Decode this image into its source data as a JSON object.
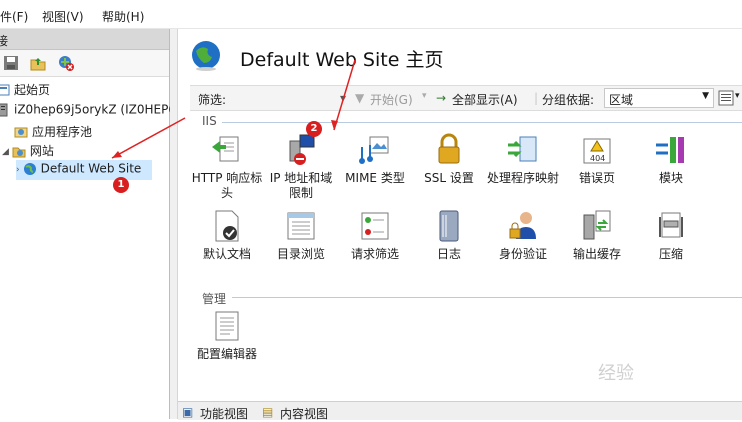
{
  "menu": {
    "items": [
      "件(F)",
      "视图(V)",
      "帮助(H)"
    ]
  },
  "connections": {
    "header": "接",
    "tree": {
      "start_page": "起始页",
      "server": "iZ0hep69j5orykZ (IZ0HEP69",
      "app_pools": "应用程序池",
      "sites": "网站",
      "default_site": "Default Web Site"
    }
  },
  "main": {
    "title": "Default Web Site 主页",
    "filter": {
      "label": "筛选:",
      "start_label": "开始(G)",
      "show_all_label": "全部显示(A)",
      "group_by_label": "分组依据:",
      "group_by_value": "区域"
    },
    "sections": {
      "iis": {
        "label": "IIS",
        "features": [
          "HTTP 响应标头",
          "IP 地址和域限制",
          "MIME 类型",
          "SSL 设置",
          "处理程序映射",
          "错误页",
          "模块",
          "默认文档",
          "目录浏览",
          "请求筛选",
          "日志",
          "身份验证",
          "输出缓存",
          "压缩"
        ]
      },
      "manage": {
        "label": "管理",
        "features": [
          "配置编辑器"
        ]
      }
    }
  },
  "bottom_tabs": {
    "features_view": "功能视图",
    "content_view": "内容视图"
  },
  "annotations": {
    "badge1": "1",
    "badge2": "2"
  },
  "watermark": "经验"
}
